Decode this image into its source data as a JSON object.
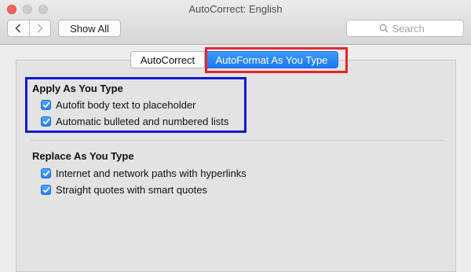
{
  "window": {
    "title": "AutoCorrect: English"
  },
  "toolbar": {
    "show_all_label": "Show All",
    "search_placeholder": "Search"
  },
  "tabs": [
    {
      "label": "AutoCorrect",
      "selected": false
    },
    {
      "label": "AutoFormat As You Type",
      "selected": true
    }
  ],
  "sections": {
    "apply": {
      "title": "Apply As You Type",
      "options": [
        {
          "label": "Autofit body text to placeholder",
          "checked": true
        },
        {
          "label": "Automatic bulleted and numbered lists",
          "checked": true
        }
      ]
    },
    "replace": {
      "title": "Replace As You Type",
      "options": [
        {
          "label": "Internet and network paths with hyperlinks",
          "checked": true
        },
        {
          "label": "Straight quotes with smart quotes",
          "checked": true
        }
      ]
    }
  },
  "annotations": {
    "highlight_red": "#e8242b",
    "highlight_blue": "#1218d2"
  },
  "colors": {
    "accent": "#1b78f2"
  }
}
